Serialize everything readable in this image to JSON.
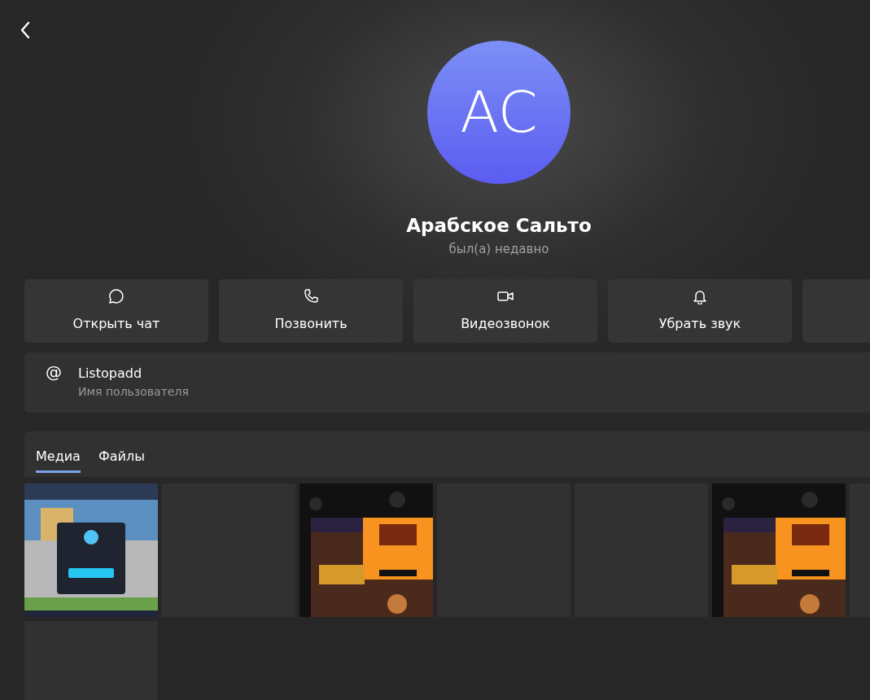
{
  "profile": {
    "initials": "AC",
    "name": "Арабское Сальто",
    "status": "был(а) недавно"
  },
  "actions": [
    {
      "kind": "chat",
      "label": "Открыть чат"
    },
    {
      "kind": "call",
      "label": "Позвонить"
    },
    {
      "kind": "video",
      "label": "Видеозвонок"
    },
    {
      "kind": "mute",
      "label": "Убрать звук"
    }
  ],
  "username": {
    "icon": "@",
    "value": "Listopadd",
    "caption": "Имя пользователя"
  },
  "tabs": [
    {
      "label": "Медиа",
      "selected": true
    },
    {
      "label": "Файлы",
      "selected": false
    }
  ],
  "media": [
    {
      "kind": "picture"
    },
    {
      "kind": "empty"
    },
    {
      "kind": "picture"
    },
    {
      "kind": "empty"
    },
    {
      "kind": "empty"
    },
    {
      "kind": "picture"
    },
    {
      "kind": "empty"
    },
    {
      "kind": "empty"
    }
  ]
}
